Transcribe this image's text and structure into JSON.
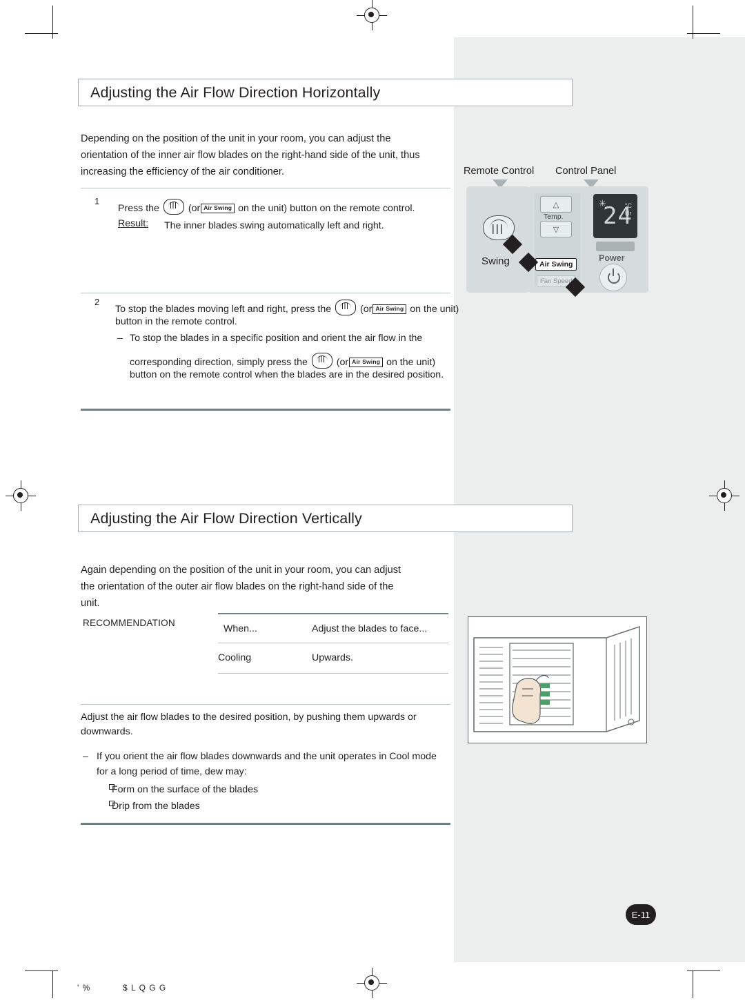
{
  "document": {
    "page_badge": "E-11",
    "footer_left": "' %",
    "footer_right": "$ L Q G G"
  },
  "section1": {
    "title": "Adjusting the Air Flow Direction Horizontally",
    "intro": "Depending on the position of the unit in your room, you can adjust the orientation of the inner air flow blades on the right-hand side of the unit, thus increasing the efficiency of the air conditioner.",
    "steps": [
      {
        "num": "1",
        "text_a": "Press the",
        "text_b": "(or",
        "key_label": "Air Swing",
        "text_c": "on the unit) button on the remote control.",
        "result_label": "Result:",
        "result_text": "The inner blades swing automatically left and right."
      },
      {
        "num": "2",
        "text_a": "To stop the blades moving left and right, press the",
        "text_b": "(or",
        "key_label": "Air Swing",
        "text_c": "on the unit)",
        "text_d": "button in the remote control.",
        "sub_dash": "–",
        "sub_a": "To stop the blades in a specific position and orient the air flow in the",
        "sub_b": "corresponding direction, simply press the",
        "sub_c": "(or",
        "sub_key": "Air Swing",
        "sub_d": "on the unit)",
        "sub_e": "button on the remote control when the blades are in the desired position."
      }
    ]
  },
  "illustration": {
    "label_remote": "Remote Control",
    "label_panel": "Control Panel",
    "swing_label": "Swing",
    "temp_word": "Temp.",
    "temp_up": "△",
    "temp_down": "▽",
    "air_swing_chip": "Air Swing",
    "fan_speed_chip": "Fan Speed",
    "power_word": "Power",
    "display_value": "24",
    "display_unit_c": "°C",
    "display_unit_hr": "Hr",
    "display_star": "✳"
  },
  "section2": {
    "title": "Adjusting the Air Flow Direction Vertically",
    "intro": "Again depending on the position of the unit in your room, you can adjust the orientation of the outer air flow blades on the right-hand side of the unit.",
    "recommendation_label": "RECOMMENDATION",
    "table": {
      "headers": [
        "When...",
        "Adjust the  blades to face..."
      ],
      "rows": [
        [
          "Cooling",
          "Upwards."
        ]
      ]
    },
    "note": "Adjust the air flow blades to the desired position, by pushing them upwards or downwards.",
    "dash": "–",
    "warning": "If you orient the air flow blades downwards and the unit operates in Cool mode for a long period of time, dew may:",
    "bullets": [
      "Form on the surface of the blades",
      "Drip from the blades"
    ]
  }
}
